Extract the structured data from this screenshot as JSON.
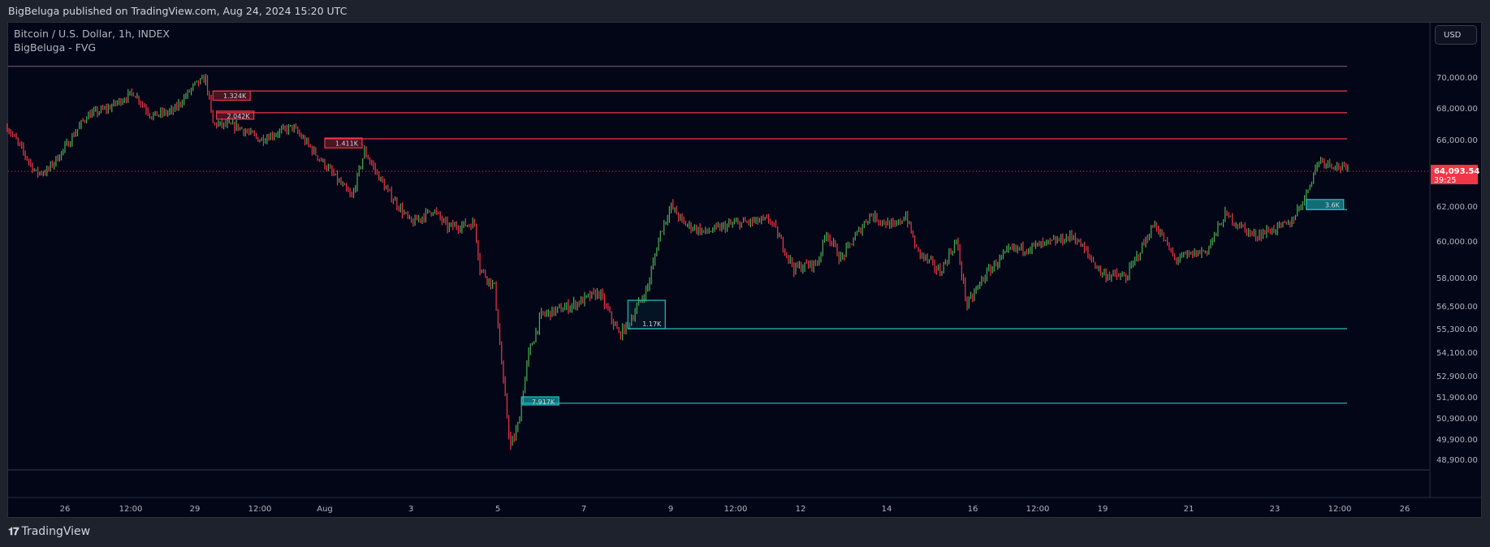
{
  "header": {
    "published": "BigBeluga published on TradingView.com, Aug 24, 2024 15:20 UTC"
  },
  "legend": {
    "symbol": "Bitcoin / U.S. Dollar, 1h, INDEX",
    "indicator": "BigBeluga - FVG"
  },
  "currency_button": "USD",
  "footer": {
    "brand": "TradingView"
  },
  "colors": {
    "up": "#4caf50",
    "down": "#f23645",
    "bear_zone": "#f23645",
    "bull_zone": "#22c1c3",
    "background": "#020617"
  },
  "chart_data": {
    "type": "ohlc",
    "interval": "1h",
    "last_price": {
      "value": "64,093.54",
      "countdown": "39:25"
    },
    "y_ticks": [
      "70,000.00",
      "68,000.00",
      "66,000.00",
      "62,000.00",
      "60,000.00",
      "58,000.00",
      "56,500.00",
      "55,300.00",
      "54,100.00",
      "52,900.00",
      "51,900.00",
      "50,900.00",
      "49,900.00",
      "48,900.00"
    ],
    "x_ticks": [
      "26",
      "12:00",
      "29",
      "12:00",
      "Aug",
      "3",
      "5",
      "7",
      "9",
      "12:00",
      "12",
      "14",
      "16",
      "12:00",
      "19",
      "21",
      "23",
      "12:00",
      "26"
    ],
    "price_path": [
      [
        "2024-07-24T16:00",
        66800
      ],
      [
        "2024-07-25T08:00",
        64000
      ],
      [
        "2024-07-25T14:00",
        64100
      ],
      [
        "2024-07-26T00:00",
        65500
      ],
      [
        "2024-07-26T12:00",
        67500
      ],
      [
        "2024-07-27T00:00",
        68000
      ],
      [
        "2024-07-27T14:00",
        69000
      ],
      [
        "2024-07-28T00:00",
        67500
      ],
      [
        "2024-07-28T12:00",
        67800
      ],
      [
        "2024-07-29T00:00",
        69500
      ],
      [
        "2024-07-29T06:00",
        69900
      ],
      [
        "2024-07-29T10:00",
        67000
      ],
      [
        "2024-07-30T00:00",
        66800
      ],
      [
        "2024-07-30T12:00",
        66000
      ],
      [
        "2024-07-31T06:00",
        66800
      ],
      [
        "2024-08-01T00:00",
        64500
      ],
      [
        "2024-08-01T15:00",
        62500
      ],
      [
        "2024-08-01T22:00",
        65300
      ],
      [
        "2024-08-02T10:00",
        63000
      ],
      [
        "2024-08-03T00:00",
        61000
      ],
      [
        "2024-08-03T12:00",
        61800
      ],
      [
        "2024-08-03T20:00",
        60800
      ],
      [
        "2024-08-04T11:00",
        61000
      ],
      [
        "2024-08-04T14:00",
        58500
      ],
      [
        "2024-08-04T22:00",
        57500
      ],
      [
        "2024-08-05T03:00",
        52500
      ],
      [
        "2024-08-05T07:00",
        49500
      ],
      [
        "2024-08-05T11:00",
        50500
      ],
      [
        "2024-08-05T17:00",
        54000
      ],
      [
        "2024-08-06T00:00",
        56000
      ],
      [
        "2024-08-06T16:00",
        56500
      ],
      [
        "2024-08-07T08:00",
        57200
      ],
      [
        "2024-08-07T19:00",
        55000
      ],
      [
        "2024-08-08T00:00",
        55500
      ],
      [
        "2024-08-08T11:00",
        57500
      ],
      [
        "2024-08-08T18:00",
        60500
      ],
      [
        "2024-08-09T00:00",
        62000
      ],
      [
        "2024-08-09T07:00",
        61000
      ],
      [
        "2024-08-09T19:00",
        60500
      ],
      [
        "2024-08-10T11:00",
        61000
      ],
      [
        "2024-08-11T07:00",
        61200
      ],
      [
        "2024-08-11T20:00",
        58500
      ],
      [
        "2024-08-12T09:00",
        58800
      ],
      [
        "2024-08-12T14:00",
        60500
      ],
      [
        "2024-08-12T22:00",
        59000
      ],
      [
        "2024-08-13T14:00",
        61500
      ],
      [
        "2024-08-14T04:00",
        60800
      ],
      [
        "2024-08-14T10:00",
        61500
      ],
      [
        "2024-08-14T16:00",
        59500
      ],
      [
        "2024-08-15T05:00",
        58300
      ],
      [
        "2024-08-15T14:00",
        60000
      ],
      [
        "2024-08-15T20:00",
        56500
      ],
      [
        "2024-08-16T05:00",
        58000
      ],
      [
        "2024-08-16T12:00",
        58800
      ],
      [
        "2024-08-16T20:00",
        59500
      ],
      [
        "2024-08-17T15:00",
        59800
      ],
      [
        "2024-08-18T07:00",
        60300
      ],
      [
        "2024-08-18T23:00",
        58200
      ],
      [
        "2024-08-19T12:00",
        58000
      ],
      [
        "2024-08-20T04:00",
        61000
      ],
      [
        "2024-08-20T15:00",
        59000
      ],
      [
        "2024-08-21T09:00",
        59500
      ],
      [
        "2024-08-21T19:00",
        61500
      ],
      [
        "2024-08-22T11:00",
        60300
      ],
      [
        "2024-08-23T07:00",
        61000
      ],
      [
        "2024-08-23T15:00",
        62500
      ],
      [
        "2024-08-23T23:00",
        64800
      ],
      [
        "2024-08-24T12:00",
        64300
      ],
      [
        "2024-08-24T15:00",
        64093.54
      ]
    ],
    "fvg_zones": [
      {
        "kind": "bearish",
        "label": "1.324K",
        "start": "2024-07-29T10:00",
        "top": 69100,
        "bottom": 68500,
        "line": 69100
      },
      {
        "kind": "bearish",
        "label": "2.042K",
        "start": "2024-07-29T12:00",
        "top": 67800,
        "bottom": 67300,
        "line": 67700
      },
      {
        "kind": "bearish",
        "label": "1.411K",
        "start": "2024-08-01T00:00",
        "top": 66100,
        "bottom": 65500,
        "line": 66050
      },
      {
        "kind": "bullish",
        "label": "1.17K",
        "start": "2024-08-08T00:00",
        "top": 56800,
        "bottom": 55300,
        "line": 55300
      },
      {
        "kind": "bullish",
        "label": "7.917K",
        "start": "2024-08-05T13:00",
        "top": 51900,
        "bottom": 51600,
        "line": 51600
      },
      {
        "kind": "bullish",
        "label": "3.6K",
        "start": "2024-08-23T16:00",
        "top": 62400,
        "bottom": 61800,
        "line": 61800
      }
    ],
    "top_line": 70700
  }
}
